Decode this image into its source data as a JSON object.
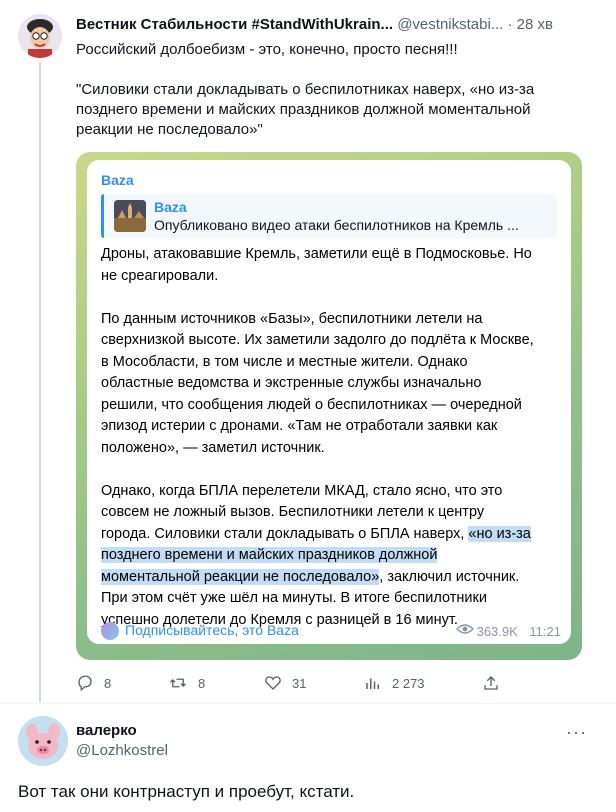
{
  "tweet": {
    "author_name": "Вестник Стабильности #StandWithUkrain...",
    "handle": "@vestnikstabi...",
    "separator": "·",
    "time": "28 хв",
    "text_line1": "Российский долбоебизм - это, конечно, просто песня!!!",
    "text_quote_1": "\"Силовики стали докладывать о беспилотниках наверх, «но из-за",
    "text_quote_2": "позднего времени и майских праздников должной моментальной",
    "text_quote_3": "реакции не последовало»\""
  },
  "telegram": {
    "channel": "Baza",
    "reply_name": "Baza",
    "reply_text": "Опубликовано видео атаки беспилотников на Кремль ...",
    "body": {
      "p1_l1": "Дроны, атаковавшие Кремль, заметили ещё в Подмосковье. Но",
      "p1_l2": "не среагировали.",
      "p2_l1": "По данным источников «Базы», беспилотники летели на",
      "p2_l2": "сверхнизкой высоте. Их заметили задолго до подлёта к Москве,",
      "p2_l3": "в Мособласти, в том числе и местные жители. Однако",
      "p2_l4": "областные ведомства и экстренные службы изначально",
      "p2_l5": "решили, что сообщения людей о беспилотниках — очередной",
      "p2_l6": "эпизод истерии с дронами. «Там не отработали заявки как",
      "p2_l7": "положено», — заметил источник.",
      "p3_l1": "Однако, когда БПЛА перелетели МКАД, стало ясно, что это",
      "p3_l2": "совсем не ложный вызов. Беспилотники летели к центру",
      "p3_l3_plain": "города. Силовики стали докладывать о БПЛА наверх, ",
      "p3_l3_hl": "«но из-за",
      "p3_l4_hl": "позднего времени и майских праздников должной",
      "p3_l5_hl": "моментальной реакции не последовало»",
      "p3_l5_plain": ", заключил источник.",
      "p3_l6": "При этом счёт уже шёл на минуты. В итоге беспилотники",
      "p3_l7": "успешно долетели до Кремля с разницей в 16 минут."
    },
    "subscribe_label": "Подписывайтесь, это Baza",
    "views": "363.9K",
    "time": "11:21"
  },
  "actions": {
    "replies": "8",
    "retweets": "8",
    "likes": "31",
    "views": "2 273"
  },
  "reply_tweet": {
    "author_name": "валерко",
    "handle": "@Lozhkostrel",
    "more": "···",
    "text": "Вот так они контрнаступ и проебут, кстати."
  }
}
